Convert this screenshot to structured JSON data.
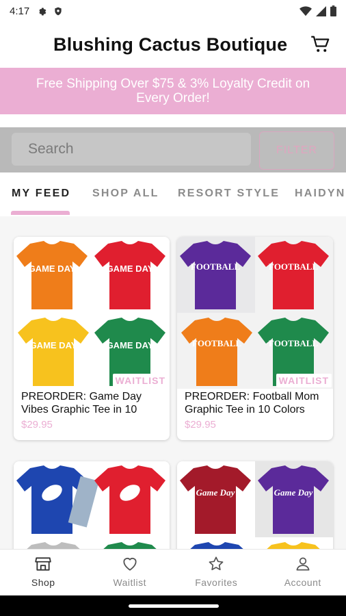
{
  "status_bar": {
    "time": "4:17"
  },
  "app": {
    "title": "Blushing Cactus Boutique"
  },
  "promo": {
    "text": "Free Shipping Over $75 & 3% Loyalty Credit on Every Order!"
  },
  "search": {
    "placeholder": "Search",
    "filter_label": "FILTER"
  },
  "tabs": [
    {
      "label": "MY FEED",
      "active": true
    },
    {
      "label": "SHOP ALL"
    },
    {
      "label": "RESORT STYLE"
    },
    {
      "label": "HAIDYN"
    }
  ],
  "products": [
    {
      "name": "PREORDER: Game Day Vibes Graphic Tee in 10",
      "price": "$29.95",
      "badge": "WAITLIST",
      "graphic": "GAME DAY"
    },
    {
      "name": "PREORDER: Football Mom Graphic Tee in 10 Colors",
      "price": "$29.95",
      "badge": "WAITLIST",
      "graphic": "FOOTBALL"
    },
    {
      "name": "",
      "price": "",
      "graphic": ""
    },
    {
      "name": "",
      "price": "",
      "graphic": "Game Day"
    }
  ],
  "bottom_nav": [
    {
      "label": "Shop",
      "icon": "store-icon",
      "active": true
    },
    {
      "label": "Waitlist",
      "icon": "heart-icon"
    },
    {
      "label": "Favorites",
      "icon": "star-icon"
    },
    {
      "label": "Account",
      "icon": "person-icon"
    }
  ],
  "colors": {
    "accent": "#ebaed3",
    "shirt_orange": "#ef7d1a",
    "shirt_red": "#e01f2f",
    "shirt_yellow": "#f7c21e",
    "shirt_green": "#1f8a4c",
    "shirt_purple": "#5b2a9a",
    "shirt_blue": "#1e46b0",
    "shirt_maroon": "#a31a2a"
  }
}
